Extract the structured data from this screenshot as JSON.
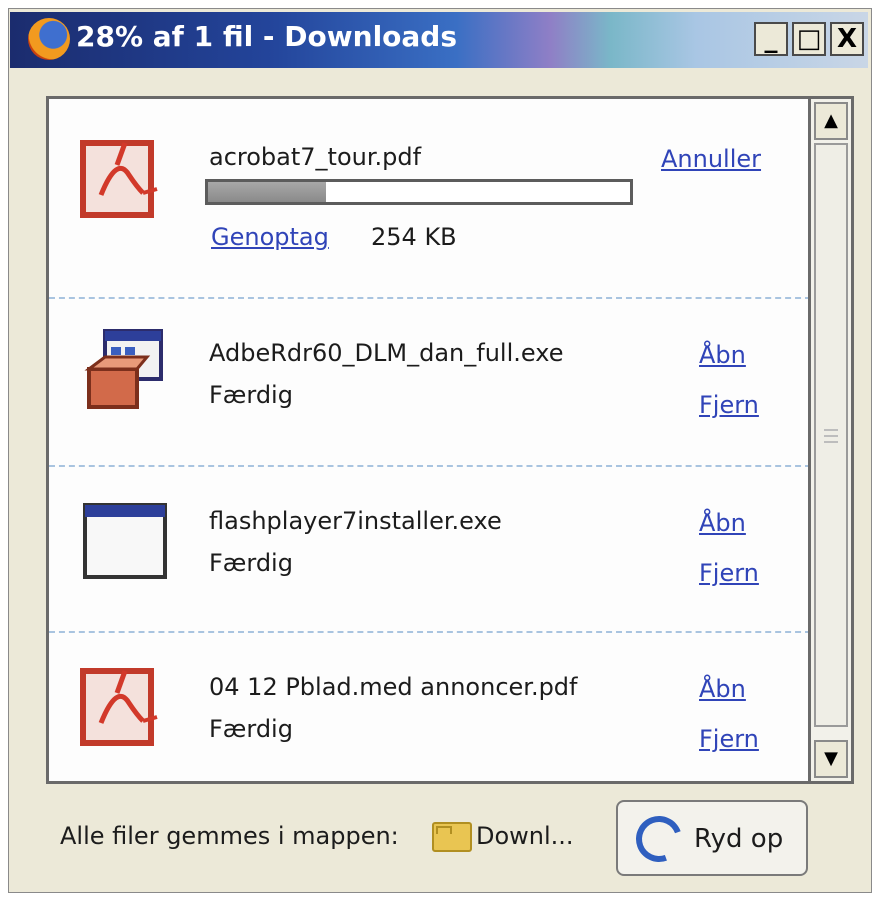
{
  "window": {
    "title": "28% af 1 fil - Downloads",
    "minimize_glyph": "_",
    "maximize_glyph": "□",
    "close_glyph": "X"
  },
  "downloads": [
    {
      "filename": "acrobat7_tour.pdf",
      "icon": "pdf-icon",
      "progress_fraction": 0.28,
      "action_links": [
        "Annuller"
      ],
      "resume_link": "Genoptag",
      "size": "254 KB"
    },
    {
      "filename": "AdbeRdr60_DLM_dan_full.exe",
      "icon": "installer-icon",
      "status": "Færdig",
      "action_links": [
        "Åbn",
        "Fjern"
      ]
    },
    {
      "filename": "flashplayer7installer.exe",
      "icon": "application-window-icon",
      "status": "Færdig",
      "action_links": [
        "Åbn",
        "Fjern"
      ]
    },
    {
      "filename": "04 12 Pblad.med annoncer.pdf",
      "icon": "pdf-icon",
      "status": "Færdig",
      "action_links": [
        "Åbn",
        "Fjern"
      ]
    }
  ],
  "footer": {
    "save_location_label": "Alle filer gemmes i mappen:",
    "folder_name": "Downl...",
    "cleanup_button": "Ryd op"
  },
  "colors": {
    "link": "#3044b8",
    "titlebar_start": "#1b2c6e",
    "window_bg": "#ece9d8"
  }
}
